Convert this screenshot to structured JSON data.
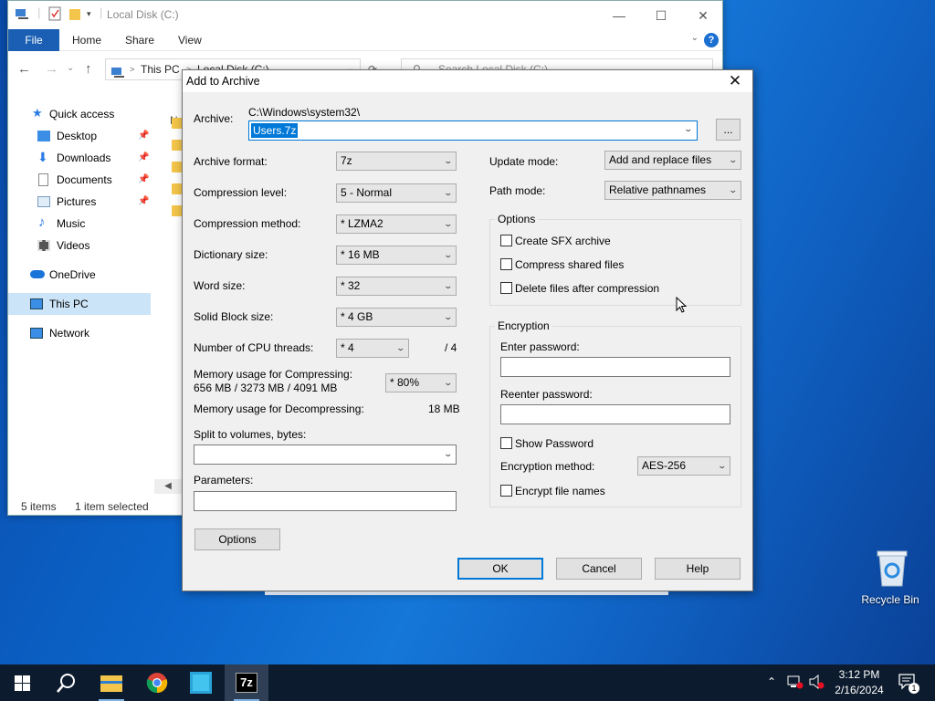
{
  "explorer": {
    "title": "Local Disk (C:)",
    "ribbon_tabs": {
      "file": "File",
      "home": "Home",
      "share": "Share",
      "view": "View"
    },
    "help_glyph": "?",
    "address": {
      "this_pc": "This PC",
      "location": "Local Disk (C:)",
      "separator": ">"
    },
    "search_placeholder": "Search Local Disk (C:)",
    "column_header": "Na",
    "nav": {
      "quick_access": "Quick access",
      "desktop": "Desktop",
      "downloads": "Downloads",
      "documents": "Documents",
      "pictures": "Pictures",
      "music": "Music",
      "videos": "Videos",
      "onedrive": "OneDrive",
      "this_pc": "This PC",
      "network": "Network"
    },
    "status": {
      "items": "5 items",
      "selected": "1 item selected"
    }
  },
  "dialog": {
    "title": "Add to Archive",
    "archive_label": "Archive:",
    "archive_path": "C:\\Windows\\system32\\",
    "archive_name": "Users.7z",
    "browse_label": "...",
    "archive_format_label": "Archive format:",
    "archive_format": "7z",
    "compression_level_label": "Compression level:",
    "compression_level": "5 - Normal",
    "compression_method_label": "Compression method:",
    "compression_method": "* LZMA2",
    "dictionary_size_label": "Dictionary size:",
    "dictionary_size": "* 16 MB",
    "word_size_label": "Word size:",
    "word_size": "* 32",
    "solid_block_label": "Solid Block size:",
    "solid_block": "* 4 GB",
    "cpu_threads_label": "Number of CPU threads:",
    "cpu_threads": "* 4",
    "cpu_threads_total": "/ 4",
    "mem_compress_label": "Memory usage for Compressing:",
    "mem_compress_value": "656 MB / 3273 MB / 4091 MB",
    "mem_compress_percent": "* 80%",
    "mem_decompress_label": "Memory usage for Decompressing:",
    "mem_decompress_value": "18 MB",
    "split_label": "Split to volumes, bytes:",
    "split_value": "",
    "parameters_label": "Parameters:",
    "parameters_value": "",
    "options_button": "Options",
    "update_mode_label": "Update mode:",
    "update_mode": "Add and replace files",
    "path_mode_label": "Path mode:",
    "path_mode": "Relative pathnames",
    "options_group": "Options",
    "create_sfx": "Create SFX archive",
    "compress_shared": "Compress shared files",
    "delete_after": "Delete files after compression",
    "encryption_group": "Encryption",
    "enter_password_label": "Enter password:",
    "reenter_password_label": "Reenter password:",
    "show_password": "Show Password",
    "encryption_method_label": "Encryption method:",
    "encryption_method": "AES-256",
    "encrypt_names": "Encrypt file names",
    "ok": "OK",
    "cancel": "Cancel",
    "help": "Help"
  },
  "desktop": {
    "recycle_bin": "Recycle Bin"
  },
  "taskbar": {
    "time": "3:12 PM",
    "date": "2/16/2024",
    "notification_count": "1",
    "apps": [
      "file-explorer",
      "chrome",
      "app",
      "7-zip"
    ],
    "sevenzip_label": "7z"
  }
}
